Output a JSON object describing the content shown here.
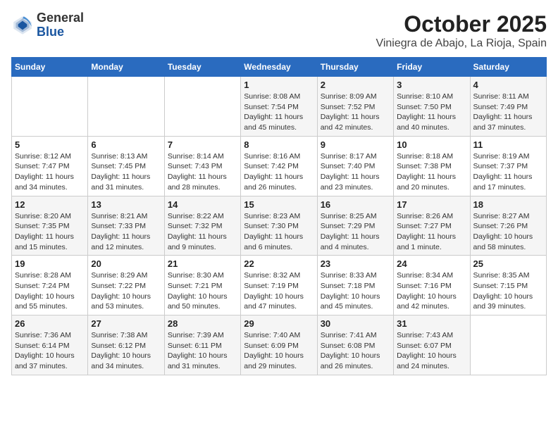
{
  "header": {
    "logo_line1": "General",
    "logo_line2": "Blue",
    "title": "October 2025",
    "subtitle": "Viniegra de Abajo, La Rioja, Spain"
  },
  "weekdays": [
    "Sunday",
    "Monday",
    "Tuesday",
    "Wednesday",
    "Thursday",
    "Friday",
    "Saturday"
  ],
  "weeks": [
    [
      {
        "day": "",
        "info": ""
      },
      {
        "day": "",
        "info": ""
      },
      {
        "day": "",
        "info": ""
      },
      {
        "day": "1",
        "info": "Sunrise: 8:08 AM\nSunset: 7:54 PM\nDaylight: 11 hours and 45 minutes."
      },
      {
        "day": "2",
        "info": "Sunrise: 8:09 AM\nSunset: 7:52 PM\nDaylight: 11 hours and 42 minutes."
      },
      {
        "day": "3",
        "info": "Sunrise: 8:10 AM\nSunset: 7:50 PM\nDaylight: 11 hours and 40 minutes."
      },
      {
        "day": "4",
        "info": "Sunrise: 8:11 AM\nSunset: 7:49 PM\nDaylight: 11 hours and 37 minutes."
      }
    ],
    [
      {
        "day": "5",
        "info": "Sunrise: 8:12 AM\nSunset: 7:47 PM\nDaylight: 11 hours and 34 minutes."
      },
      {
        "day": "6",
        "info": "Sunrise: 8:13 AM\nSunset: 7:45 PM\nDaylight: 11 hours and 31 minutes."
      },
      {
        "day": "7",
        "info": "Sunrise: 8:14 AM\nSunset: 7:43 PM\nDaylight: 11 hours and 28 minutes."
      },
      {
        "day": "8",
        "info": "Sunrise: 8:16 AM\nSunset: 7:42 PM\nDaylight: 11 hours and 26 minutes."
      },
      {
        "day": "9",
        "info": "Sunrise: 8:17 AM\nSunset: 7:40 PM\nDaylight: 11 hours and 23 minutes."
      },
      {
        "day": "10",
        "info": "Sunrise: 8:18 AM\nSunset: 7:38 PM\nDaylight: 11 hours and 20 minutes."
      },
      {
        "day": "11",
        "info": "Sunrise: 8:19 AM\nSunset: 7:37 PM\nDaylight: 11 hours and 17 minutes."
      }
    ],
    [
      {
        "day": "12",
        "info": "Sunrise: 8:20 AM\nSunset: 7:35 PM\nDaylight: 11 hours and 15 minutes."
      },
      {
        "day": "13",
        "info": "Sunrise: 8:21 AM\nSunset: 7:33 PM\nDaylight: 11 hours and 12 minutes."
      },
      {
        "day": "14",
        "info": "Sunrise: 8:22 AM\nSunset: 7:32 PM\nDaylight: 11 hours and 9 minutes."
      },
      {
        "day": "15",
        "info": "Sunrise: 8:23 AM\nSunset: 7:30 PM\nDaylight: 11 hours and 6 minutes."
      },
      {
        "day": "16",
        "info": "Sunrise: 8:25 AM\nSunset: 7:29 PM\nDaylight: 11 hours and 4 minutes."
      },
      {
        "day": "17",
        "info": "Sunrise: 8:26 AM\nSunset: 7:27 PM\nDaylight: 11 hours and 1 minute."
      },
      {
        "day": "18",
        "info": "Sunrise: 8:27 AM\nSunset: 7:26 PM\nDaylight: 10 hours and 58 minutes."
      }
    ],
    [
      {
        "day": "19",
        "info": "Sunrise: 8:28 AM\nSunset: 7:24 PM\nDaylight: 10 hours and 55 minutes."
      },
      {
        "day": "20",
        "info": "Sunrise: 8:29 AM\nSunset: 7:22 PM\nDaylight: 10 hours and 53 minutes."
      },
      {
        "day": "21",
        "info": "Sunrise: 8:30 AM\nSunset: 7:21 PM\nDaylight: 10 hours and 50 minutes."
      },
      {
        "day": "22",
        "info": "Sunrise: 8:32 AM\nSunset: 7:19 PM\nDaylight: 10 hours and 47 minutes."
      },
      {
        "day": "23",
        "info": "Sunrise: 8:33 AM\nSunset: 7:18 PM\nDaylight: 10 hours and 45 minutes."
      },
      {
        "day": "24",
        "info": "Sunrise: 8:34 AM\nSunset: 7:16 PM\nDaylight: 10 hours and 42 minutes."
      },
      {
        "day": "25",
        "info": "Sunrise: 8:35 AM\nSunset: 7:15 PM\nDaylight: 10 hours and 39 minutes."
      }
    ],
    [
      {
        "day": "26",
        "info": "Sunrise: 7:36 AM\nSunset: 6:14 PM\nDaylight: 10 hours and 37 minutes."
      },
      {
        "day": "27",
        "info": "Sunrise: 7:38 AM\nSunset: 6:12 PM\nDaylight: 10 hours and 34 minutes."
      },
      {
        "day": "28",
        "info": "Sunrise: 7:39 AM\nSunset: 6:11 PM\nDaylight: 10 hours and 31 minutes."
      },
      {
        "day": "29",
        "info": "Sunrise: 7:40 AM\nSunset: 6:09 PM\nDaylight: 10 hours and 29 minutes."
      },
      {
        "day": "30",
        "info": "Sunrise: 7:41 AM\nSunset: 6:08 PM\nDaylight: 10 hours and 26 minutes."
      },
      {
        "day": "31",
        "info": "Sunrise: 7:43 AM\nSunset: 6:07 PM\nDaylight: 10 hours and 24 minutes."
      },
      {
        "day": "",
        "info": ""
      }
    ]
  ]
}
